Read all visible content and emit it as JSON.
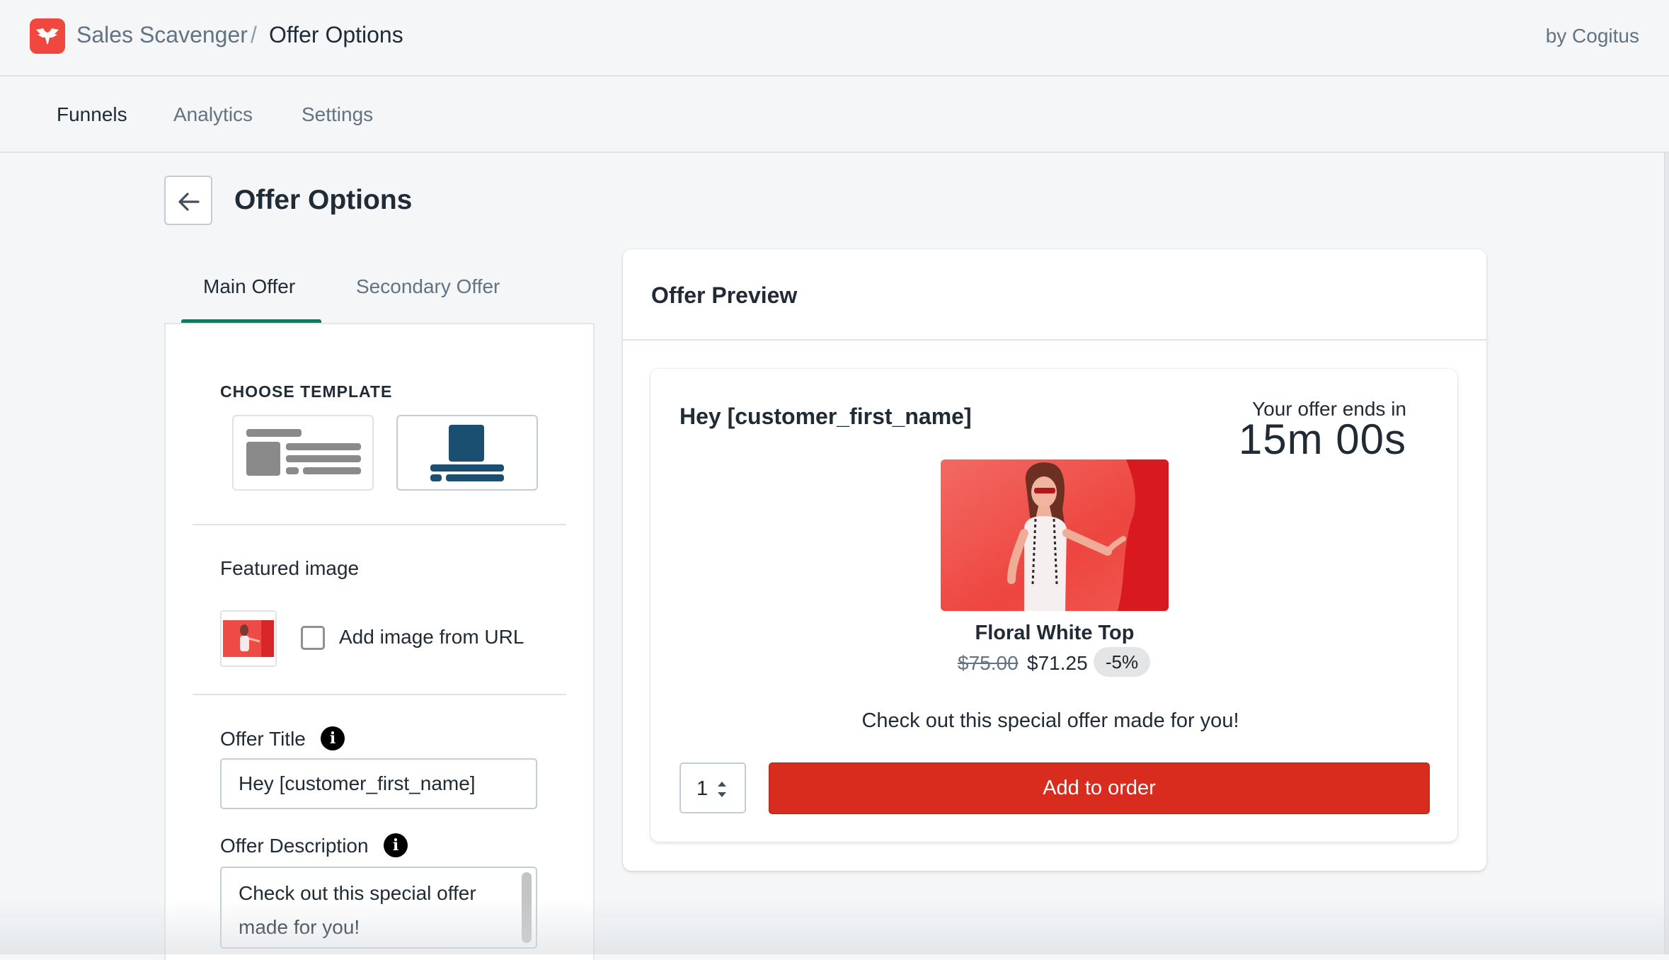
{
  "header": {
    "app_name": "Sales Scavenger",
    "separator": "/",
    "page_name": "Offer Options",
    "byline": "by Cogitus",
    "logo_icon": "eagle-logo-icon",
    "brand_color": "#f0483e"
  },
  "nav": {
    "items": [
      {
        "label": "Funnels",
        "active": true
      },
      {
        "label": "Analytics",
        "active": false
      },
      {
        "label": "Settings",
        "active": false
      }
    ]
  },
  "page": {
    "title": "Offer Options",
    "back_icon": "arrow-left-icon"
  },
  "tabs": [
    {
      "label": "Main Offer",
      "active": true
    },
    {
      "label": "Secondary Offer",
      "active": false
    }
  ],
  "form": {
    "template_heading": "CHOOSE TEMPLATE",
    "templates": [
      {
        "name": "horizontal-layout",
        "selected": false
      },
      {
        "name": "vertical-layout",
        "selected": true
      }
    ],
    "featured_image_label": "Featured image",
    "add_from_url_label": "Add image from URL",
    "add_from_url_checked": false,
    "offer_title_label": "Offer Title",
    "offer_title_value": "Hey [customer_first_name]",
    "offer_description_label": "Offer Description",
    "offer_description_value": "Check out this special offer made for you!",
    "info_icon": "info-icon",
    "accent_color": "#008060"
  },
  "preview": {
    "title": "Offer Preview",
    "greeting": "Hey [customer_first_name]",
    "timer_label": "Your offer ends in",
    "timer_value": "15m 00s",
    "product_name": "Floral White Top",
    "price_original": "$75.00",
    "price_sale": "$71.25",
    "discount": "-5%",
    "description": "Check out this special offer made for you!",
    "quantity": "1",
    "add_button_label": "Add to order",
    "button_color": "#d72c1e"
  }
}
